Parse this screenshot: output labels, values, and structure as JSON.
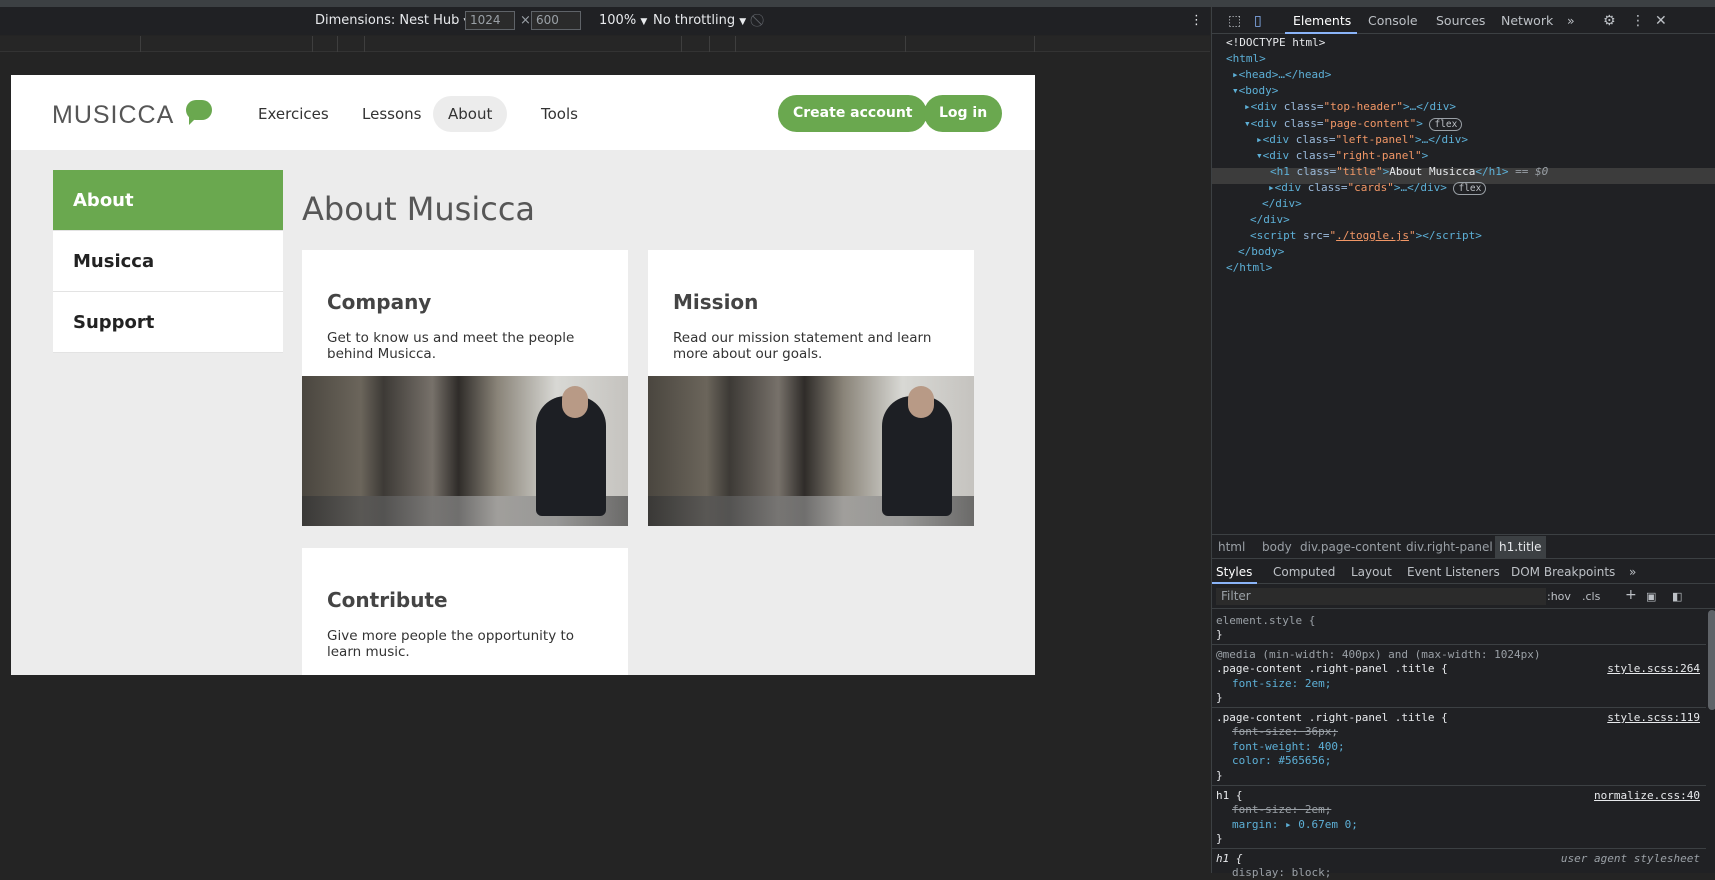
{
  "device_toolbar": {
    "dimensions_label": "Dimensions: Nest Hub",
    "width": "1024",
    "height": "600",
    "times": "×",
    "zoom": "100%",
    "throttling": "No throttling"
  },
  "site": {
    "logo": "MUSICCA",
    "nav": [
      "Exercices",
      "Lessons",
      "About",
      "Tools"
    ],
    "create_account": "Create account",
    "login": "Log in",
    "left_panel": [
      "About",
      "Musicca",
      "Support"
    ],
    "title": "About Musicca",
    "cards": [
      {
        "title": "Company",
        "text": "Get to know us and meet the people behind Musicca."
      },
      {
        "title": "Mission",
        "text": "Read our mission statement and learn more about our goals."
      },
      {
        "title": "Contribute",
        "text": "Give more people the opportunity to learn music."
      }
    ]
  },
  "devtools": {
    "tabs": [
      "Elements",
      "Console",
      "Sources",
      "Network",
      "»"
    ],
    "tree": {
      "doctype": "<!DOCTYPE html>",
      "html_open": "<html>",
      "head": "<head>…</head>",
      "body_open": "<body>",
      "top_header_class": "top-header",
      "page_content_class": "page-content",
      "left_panel_class": "left-panel",
      "right_panel_class": "right-panel",
      "title_class": "title",
      "title_text": "About Musicca",
      "eq": "== $0",
      "cards_class": "cards",
      "flex": "flex",
      "script_src": "./toggle.js",
      "body_close": "</body>",
      "html_close": "</html>",
      "div_close": "</div>"
    },
    "breadcrumbs": [
      "html",
      "body",
      "div.page-content",
      "div.right-panel",
      "h1.title"
    ],
    "style_tabs": [
      "Styles",
      "Computed",
      "Layout",
      "Event Listeners",
      "DOM Breakpoints",
      "»"
    ],
    "filter_placeholder": "Filter",
    "hov": ":hov",
    "cls": ".cls",
    "rules": {
      "element_style": "element.style {",
      "media": "@media (min-width: 400px) and (max-width: 1024px)",
      "sel1": ".page-content .right-panel .title {",
      "r1_prop": "font-size: 2em;",
      "src1": "style.scss:264",
      "sel2": ".page-content .right-panel .title {",
      "src2": "style.scss:119",
      "r2_p1": "font-size: 36px;",
      "r2_p2": "font-weight: 400;",
      "r2_p3": "color: #565656;",
      "sel3": "h1 {",
      "src3": "normalize.css:40",
      "r3_p1": "font-size: 2em;",
      "r3_p2": "margin: ▸ 0.67em 0;",
      "sel4": "h1 {",
      "src4": "user agent stylesheet",
      "r4_p1": "display: block;",
      "close": "}"
    }
  }
}
